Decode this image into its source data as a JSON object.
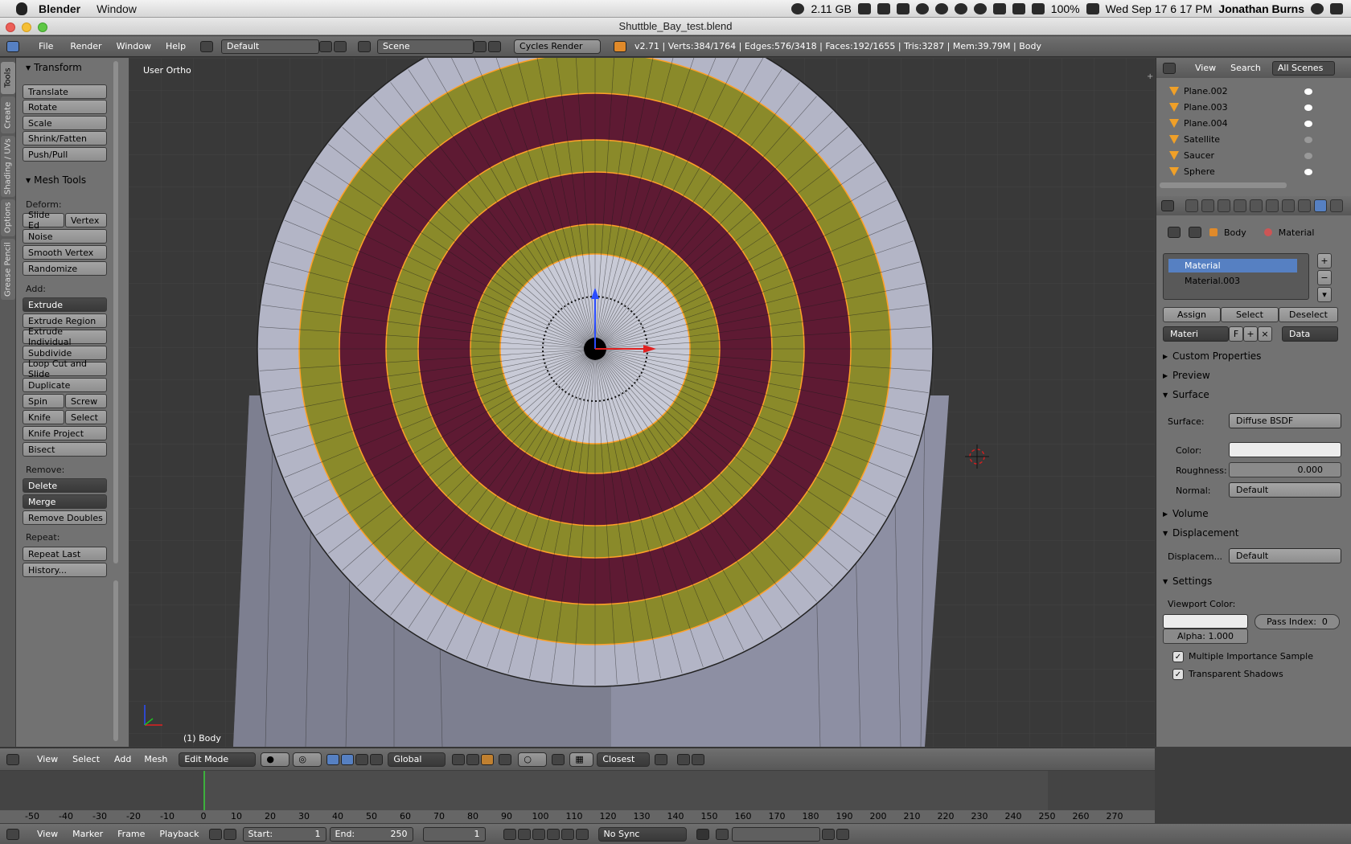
{
  "menubar": {
    "app": "Blender",
    "window_menu": "Window",
    "memory": "2.11 GB",
    "battery": "100%",
    "datetime": "Wed Sep 17  6 17 PM",
    "user": "Jonathan Burns"
  },
  "window_title": "Shuttble_Bay_test.blend",
  "info_header": {
    "menu": [
      "File",
      "Render",
      "Window",
      "Help"
    ],
    "layout": "Default",
    "scene": "Scene",
    "engine": "Cycles Render",
    "stats": "v2.71 | Verts:384/1764 | Edges:576/3418 | Faces:192/1655 | Tris:3287 | Mem:39.79M | Body"
  },
  "tool_tabs": [
    "Tools",
    "Create",
    "Shading / UVs",
    "Options",
    "Grease Pencil"
  ],
  "tool_shelf": {
    "transform_title": "Transform",
    "transform": [
      "Translate",
      "Rotate",
      "Scale",
      "Shrink/Fatten",
      "Push/Pull"
    ],
    "meshtools_title": "Mesh Tools",
    "deform_label": "Deform:",
    "slide_edge": "Slide Ed",
    "vertex": "Vertex",
    "deform": [
      "Noise",
      "Smooth Vertex",
      "Randomize"
    ],
    "add_label": "Add:",
    "extrude": "Extrude",
    "add": [
      "Extrude Region",
      "Extrude Individual",
      "Subdivide",
      "Loop Cut and Slide",
      "Duplicate"
    ],
    "spin": "Spin",
    "screw": "Screw",
    "knife": "Knife",
    "select": "Select",
    "add2": [
      "Knife Project",
      "Bisect"
    ],
    "remove_label": "Remove:",
    "delete": "Delete",
    "merge": "Merge",
    "remove_doubles": "Remove Doubles",
    "repeat_label": "Repeat:",
    "repeat_last": "Repeat Last",
    "history": "History..."
  },
  "viewport": {
    "view_label": "User Ortho",
    "object_label": "(1) Body"
  },
  "outliner": {
    "view": "View",
    "search": "Search",
    "scenes": "All Scenes",
    "items": [
      "Plane.002",
      "Plane.003",
      "Plane.004",
      "Satellite",
      "Saucer",
      "Sphere"
    ]
  },
  "properties": {
    "breadcrumb_object": "Body",
    "breadcrumb_material": "Material",
    "slots": [
      "Material",
      "Material.003"
    ],
    "assign": "Assign",
    "select": "Select",
    "deselect": "Deselect",
    "mat_name": "Materi",
    "fake": "F",
    "link": "Data",
    "custom_props": "Custom Properties",
    "preview": "Preview",
    "surface_title": "Surface",
    "surface_label": "Surface:",
    "surface_value": "Diffuse BSDF",
    "color_label": "Color:",
    "roughness_label": "Roughness:",
    "roughness_value": "0.000",
    "normal_label": "Normal:",
    "normal_value": "Default",
    "volume": "Volume",
    "displacement_title": "Displacement",
    "displacement_label": "Displacem...",
    "displacement_value": "Default",
    "settings": "Settings",
    "viewport_color_label": "Viewport Color:",
    "pass_index": "Pass Index:",
    "pass_value": "0",
    "alpha": "Alpha:",
    "alpha_value": "1.000",
    "mis": "Multiple Importance Sample",
    "transparent": "Transparent Shadows"
  },
  "view3d_header": {
    "menu": [
      "View",
      "Select",
      "Add",
      "Mesh"
    ],
    "mode": "Edit Mode",
    "orientation": "Global",
    "snap": "Closest"
  },
  "timeline": {
    "ticks": [
      "-50",
      "-40",
      "-30",
      "-20",
      "-10",
      "0",
      "10",
      "20",
      "30",
      "40",
      "50",
      "60",
      "70",
      "80",
      "90",
      "100",
      "110",
      "120",
      "130",
      "140",
      "150",
      "160",
      "170",
      "180",
      "190",
      "200",
      "210",
      "220",
      "230",
      "240",
      "250",
      "260",
      "270"
    ],
    "menu": [
      "View",
      "Marker",
      "Frame",
      "Playback"
    ],
    "start_label": "Start:",
    "start": "1",
    "end_label": "End:",
    "end": "250",
    "current": "1",
    "sync": "No Sync"
  }
}
